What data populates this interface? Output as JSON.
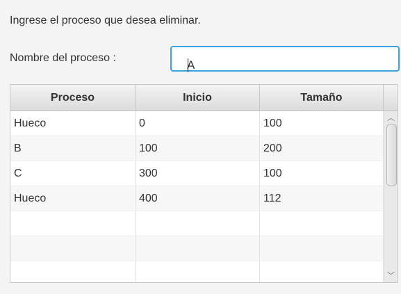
{
  "instruction": "Ingrese el proceso que desea eliminar.",
  "form": {
    "label": "Nombre del proceso :",
    "value": "A"
  },
  "table": {
    "columns": [
      "Proceso",
      "Inicio",
      "Tamaño"
    ],
    "rows": [
      [
        "Hueco",
        "0",
        "100"
      ],
      [
        "B",
        "100",
        "200"
      ],
      [
        "C",
        "300",
        "100"
      ],
      [
        "Hueco",
        "400",
        "112"
      ]
    ]
  },
  "colors": {
    "focus_border": "#39a3dd"
  }
}
